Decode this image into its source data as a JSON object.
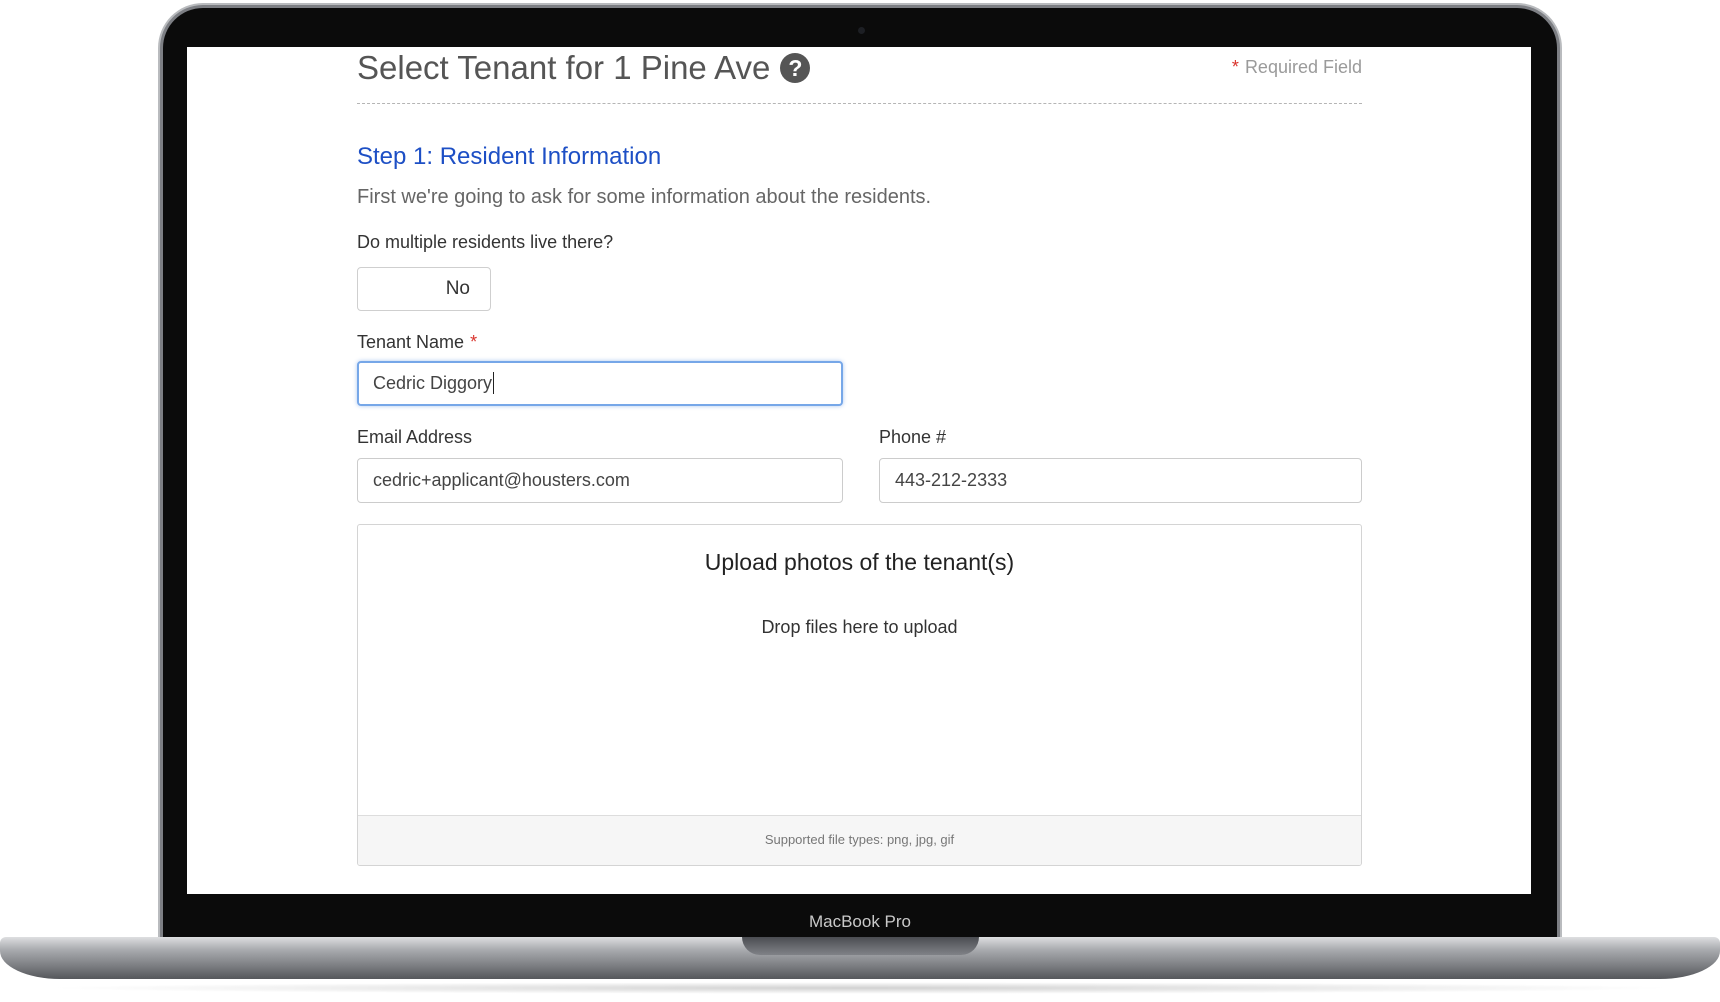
{
  "device": {
    "label": "MacBook Pro"
  },
  "page": {
    "title": "Select Tenant for 1 Pine Ave",
    "help_icon": "question-circle-icon",
    "required_note": {
      "star": "*",
      "text": "Required Field"
    }
  },
  "step": {
    "title": "Step 1: Resident Information",
    "description": "First we're going to ask for some information about the residents."
  },
  "multiple_residents": {
    "question": "Do multiple residents live there?",
    "value": "No"
  },
  "tenant_name": {
    "label": "Tenant Name",
    "required_star": "*",
    "value": "Cedric Diggory"
  },
  "email": {
    "label": "Email Address",
    "value": "cedric+applicant@housters.com"
  },
  "phone": {
    "label": "Phone #",
    "value": "443-212-2333"
  },
  "upload": {
    "title": "Upload photos of the tenant(s)",
    "drop_text": "Drop files here to upload",
    "supported": "Supported file types: png, jpg, gif"
  },
  "colors": {
    "step_title": "#1d4fc5",
    "required_star": "#d9332c",
    "focus_ring": "#76a7e8"
  }
}
